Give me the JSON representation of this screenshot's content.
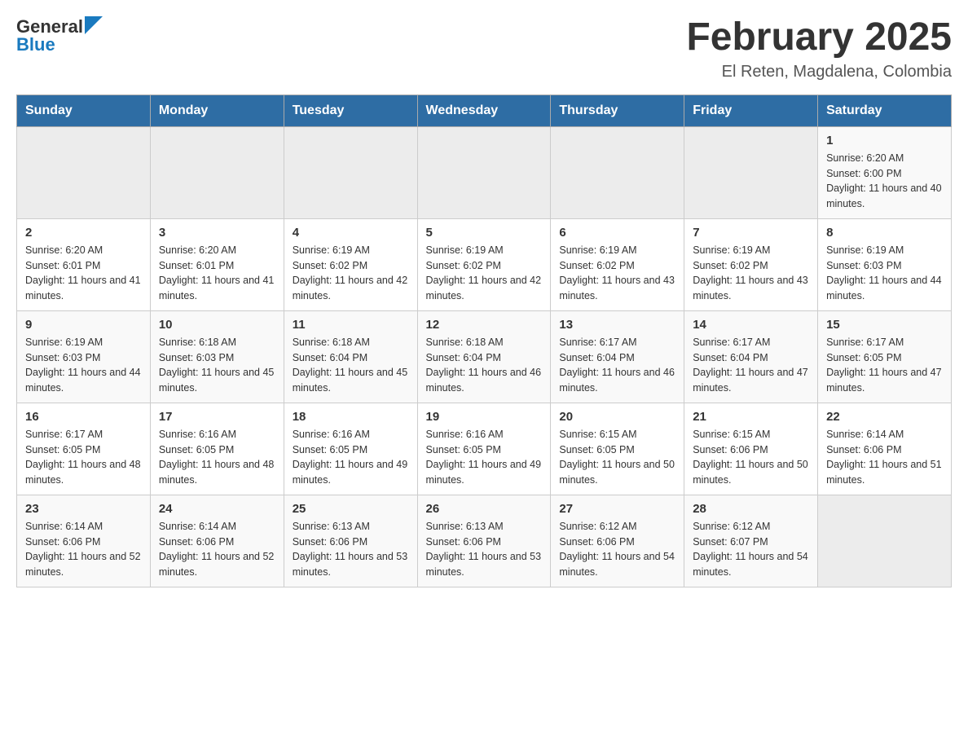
{
  "header": {
    "logo_general": "General",
    "logo_blue": "Blue",
    "title": "February 2025",
    "subtitle": "El Reten, Magdalena, Colombia"
  },
  "weekdays": [
    "Sunday",
    "Monday",
    "Tuesday",
    "Wednesday",
    "Thursday",
    "Friday",
    "Saturday"
  ],
  "rows": [
    {
      "days": [
        {
          "number": "",
          "info": ""
        },
        {
          "number": "",
          "info": ""
        },
        {
          "number": "",
          "info": ""
        },
        {
          "number": "",
          "info": ""
        },
        {
          "number": "",
          "info": ""
        },
        {
          "number": "",
          "info": ""
        },
        {
          "number": "1",
          "info": "Sunrise: 6:20 AM\nSunset: 6:00 PM\nDaylight: 11 hours and 40 minutes."
        }
      ]
    },
    {
      "days": [
        {
          "number": "2",
          "info": "Sunrise: 6:20 AM\nSunset: 6:01 PM\nDaylight: 11 hours and 41 minutes."
        },
        {
          "number": "3",
          "info": "Sunrise: 6:20 AM\nSunset: 6:01 PM\nDaylight: 11 hours and 41 minutes."
        },
        {
          "number": "4",
          "info": "Sunrise: 6:19 AM\nSunset: 6:02 PM\nDaylight: 11 hours and 42 minutes."
        },
        {
          "number": "5",
          "info": "Sunrise: 6:19 AM\nSunset: 6:02 PM\nDaylight: 11 hours and 42 minutes."
        },
        {
          "number": "6",
          "info": "Sunrise: 6:19 AM\nSunset: 6:02 PM\nDaylight: 11 hours and 43 minutes."
        },
        {
          "number": "7",
          "info": "Sunrise: 6:19 AM\nSunset: 6:02 PM\nDaylight: 11 hours and 43 minutes."
        },
        {
          "number": "8",
          "info": "Sunrise: 6:19 AM\nSunset: 6:03 PM\nDaylight: 11 hours and 44 minutes."
        }
      ]
    },
    {
      "days": [
        {
          "number": "9",
          "info": "Sunrise: 6:19 AM\nSunset: 6:03 PM\nDaylight: 11 hours and 44 minutes."
        },
        {
          "number": "10",
          "info": "Sunrise: 6:18 AM\nSunset: 6:03 PM\nDaylight: 11 hours and 45 minutes."
        },
        {
          "number": "11",
          "info": "Sunrise: 6:18 AM\nSunset: 6:04 PM\nDaylight: 11 hours and 45 minutes."
        },
        {
          "number": "12",
          "info": "Sunrise: 6:18 AM\nSunset: 6:04 PM\nDaylight: 11 hours and 46 minutes."
        },
        {
          "number": "13",
          "info": "Sunrise: 6:17 AM\nSunset: 6:04 PM\nDaylight: 11 hours and 46 minutes."
        },
        {
          "number": "14",
          "info": "Sunrise: 6:17 AM\nSunset: 6:04 PM\nDaylight: 11 hours and 47 minutes."
        },
        {
          "number": "15",
          "info": "Sunrise: 6:17 AM\nSunset: 6:05 PM\nDaylight: 11 hours and 47 minutes."
        }
      ]
    },
    {
      "days": [
        {
          "number": "16",
          "info": "Sunrise: 6:17 AM\nSunset: 6:05 PM\nDaylight: 11 hours and 48 minutes."
        },
        {
          "number": "17",
          "info": "Sunrise: 6:16 AM\nSunset: 6:05 PM\nDaylight: 11 hours and 48 minutes."
        },
        {
          "number": "18",
          "info": "Sunrise: 6:16 AM\nSunset: 6:05 PM\nDaylight: 11 hours and 49 minutes."
        },
        {
          "number": "19",
          "info": "Sunrise: 6:16 AM\nSunset: 6:05 PM\nDaylight: 11 hours and 49 minutes."
        },
        {
          "number": "20",
          "info": "Sunrise: 6:15 AM\nSunset: 6:05 PM\nDaylight: 11 hours and 50 minutes."
        },
        {
          "number": "21",
          "info": "Sunrise: 6:15 AM\nSunset: 6:06 PM\nDaylight: 11 hours and 50 minutes."
        },
        {
          "number": "22",
          "info": "Sunrise: 6:14 AM\nSunset: 6:06 PM\nDaylight: 11 hours and 51 minutes."
        }
      ]
    },
    {
      "days": [
        {
          "number": "23",
          "info": "Sunrise: 6:14 AM\nSunset: 6:06 PM\nDaylight: 11 hours and 52 minutes."
        },
        {
          "number": "24",
          "info": "Sunrise: 6:14 AM\nSunset: 6:06 PM\nDaylight: 11 hours and 52 minutes."
        },
        {
          "number": "25",
          "info": "Sunrise: 6:13 AM\nSunset: 6:06 PM\nDaylight: 11 hours and 53 minutes."
        },
        {
          "number": "26",
          "info": "Sunrise: 6:13 AM\nSunset: 6:06 PM\nDaylight: 11 hours and 53 minutes."
        },
        {
          "number": "27",
          "info": "Sunrise: 6:12 AM\nSunset: 6:06 PM\nDaylight: 11 hours and 54 minutes."
        },
        {
          "number": "28",
          "info": "Sunrise: 6:12 AM\nSunset: 6:07 PM\nDaylight: 11 hours and 54 minutes."
        },
        {
          "number": "",
          "info": ""
        }
      ]
    }
  ]
}
